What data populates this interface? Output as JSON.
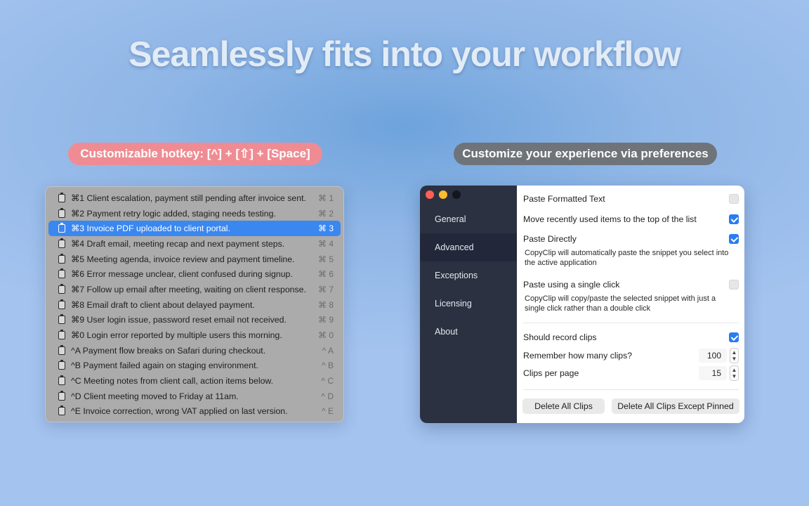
{
  "headline": "Seamlessly fits into your workflow",
  "hotkey_pill": "Customizable hotkey: [^] + [⇧] + [Space]",
  "prefs_pill": "Customize your experience via preferences",
  "clips": [
    {
      "text": "⌘1 Client escalation, payment still pending after invoice sent.",
      "key": "⌘ 1"
    },
    {
      "text": "⌘2 Payment retry logic added, staging needs testing.",
      "key": "⌘ 2"
    },
    {
      "text": "⌘3 Invoice PDF uploaded to client portal.",
      "key": "⌘ 3",
      "selected": true
    },
    {
      "text": "⌘4 Draft email, meeting recap and next payment steps.",
      "key": "⌘ 4"
    },
    {
      "text": "⌘5 Meeting agenda, invoice review and payment timeline.",
      "key": "⌘ 5"
    },
    {
      "text": "⌘6 Error message unclear, client confused during signup.",
      "key": "⌘ 6"
    },
    {
      "text": "⌘7 Follow up email after meeting, waiting on client response.",
      "key": "⌘ 7"
    },
    {
      "text": "⌘8 Email draft to client about delayed payment.",
      "key": "⌘ 8"
    },
    {
      "text": "⌘9 User login issue, password reset email not received.",
      "key": "⌘ 9"
    },
    {
      "text": "⌘0 Login error reported by multiple users this morning.",
      "key": "⌘ 0"
    },
    {
      "text": "^A Payment flow breaks on Safari during checkout.",
      "key": "^ A"
    },
    {
      "text": "^B Payment failed again on staging environment.",
      "key": "^ B"
    },
    {
      "text": "^C Meeting notes from client call, action items below.",
      "key": "^ C"
    },
    {
      "text": "^D Client meeting moved to Friday at 11am.",
      "key": "^ D"
    },
    {
      "text": "^E Invoice correction, wrong VAT applied on last version.",
      "key": "^ E"
    }
  ],
  "sidebar": {
    "items": [
      "General",
      "Advanced",
      "Exceptions",
      "Licensing",
      "About"
    ],
    "active": "Advanced"
  },
  "prefs": {
    "paste_formatted": {
      "label": "Paste Formatted Text",
      "checked": false
    },
    "move_recent": {
      "label": "Move recently used items to the top of the list",
      "checked": true
    },
    "paste_directly": {
      "label": "Paste Directly",
      "checked": true,
      "desc": "CopyClip will automatically paste the snippet you select into the active application"
    },
    "single_click": {
      "label": "Paste using a single click",
      "checked": false,
      "desc": "CopyClip will copy/paste the selected snippet with just a single click rather than a double click"
    },
    "record_clips": {
      "label": "Should record clips",
      "checked": true
    },
    "remember": {
      "label": "Remember how many clips?",
      "value": "100"
    },
    "per_page": {
      "label": "Clips per page",
      "value": "15"
    },
    "delete_all": "Delete All Clips",
    "delete_except_pinned": "Delete All Clips Except Pinned"
  },
  "colors": {
    "accent": "#2a7cf1",
    "selection": "#3a87f0",
    "hotkey_pill": "#ef8c93",
    "prefs_pill": "#6e7479",
    "sidebar": "#2b3141"
  }
}
